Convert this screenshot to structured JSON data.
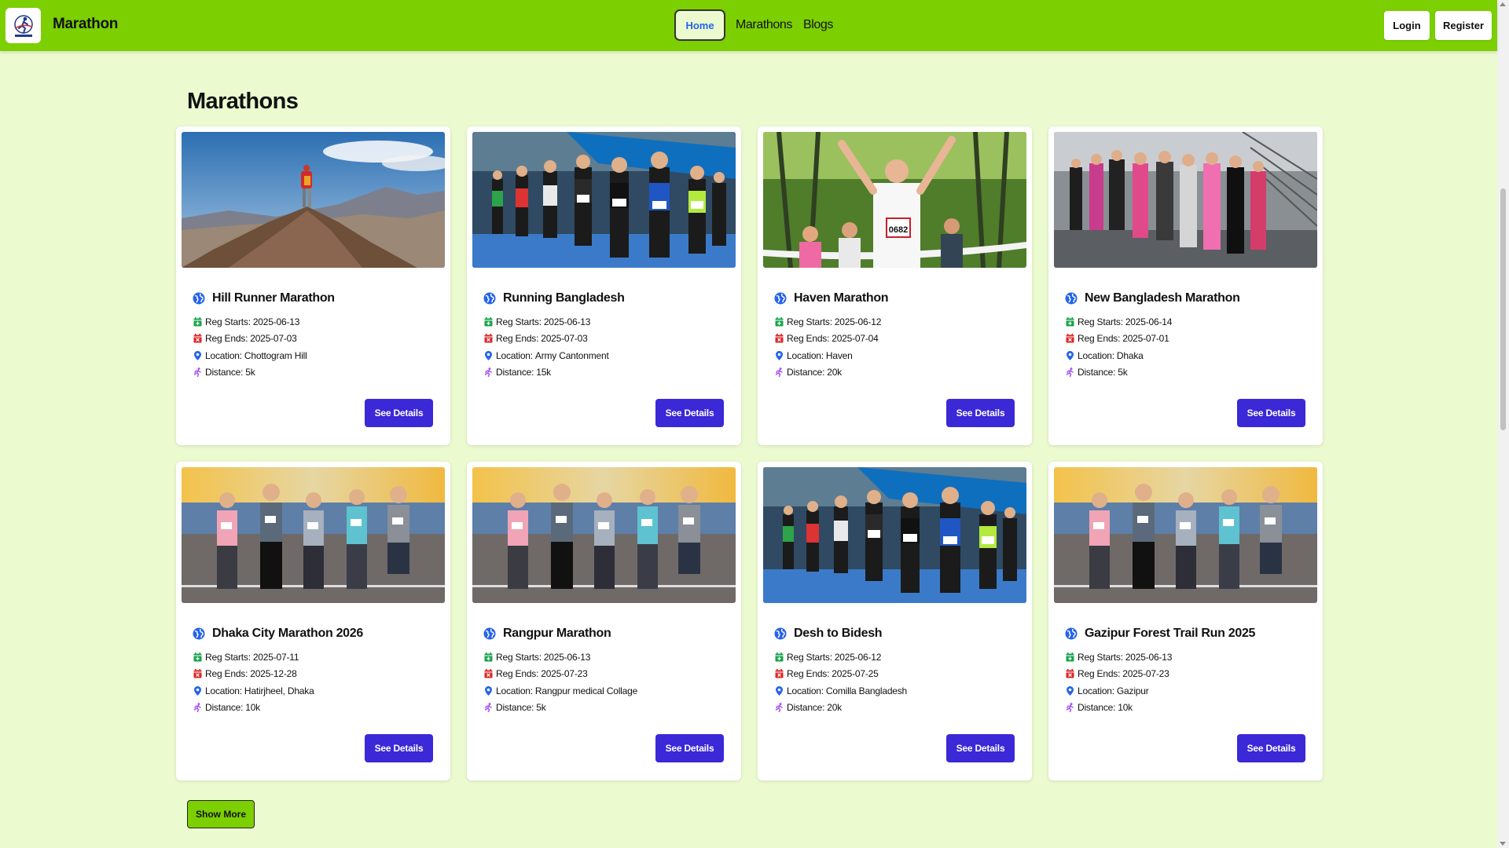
{
  "navbar": {
    "brand": "Marathon",
    "links": [
      {
        "label": "Home",
        "active": true
      },
      {
        "label": "Marathons"
      },
      {
        "label": "Blogs"
      }
    ],
    "login_label": "Login",
    "register_label": "Register"
  },
  "section_title": "Marathons",
  "labels": {
    "reg_starts": "Reg Starts:",
    "reg_ends": "Reg Ends:",
    "location": "Location:",
    "distance": "Distance:",
    "see_details": "See Details"
  },
  "cards": [
    {
      "title": "Hill Runner Marathon",
      "reg_starts": "2025-06-13",
      "reg_ends": "2025-07-03",
      "location": "Chottogram Hill",
      "distance": "5k",
      "image": "mountain"
    },
    {
      "title": "Running Bangladesh",
      "reg_starts": "2025-06-13",
      "reg_ends": "2025-07-03",
      "location": "Army Cantonment",
      "distance": "15k",
      "image": "crowd-race"
    },
    {
      "title": "Haven Marathon",
      "reg_starts": "2025-06-12",
      "reg_ends": "2025-07-04",
      "location": "Haven",
      "distance": "20k",
      "image": "finish-line"
    },
    {
      "title": "New Bangladesh Marathon",
      "reg_starts": "2025-06-14",
      "reg_ends": "2025-07-01",
      "location": "Dhaka",
      "distance": "5k",
      "image": "bridge-race"
    },
    {
      "title": "Dhaka City Marathon 2026",
      "reg_starts": "2025-07-11",
      "reg_ends": "2025-12-28",
      "location": "Hatirjheel, Dhaka",
      "distance": "10k",
      "image": "track-group"
    },
    {
      "title": "Rangpur Marathon",
      "reg_starts": "2025-06-13",
      "reg_ends": "2025-07-23",
      "location": "Rangpur medical Collage",
      "distance": "5k",
      "image": "track-group"
    },
    {
      "title": "Desh to Bidesh",
      "reg_starts": "2025-06-12",
      "reg_ends": "2025-07-25",
      "location": "Comilla Bangladesh",
      "distance": "20k",
      "image": "crowd-race"
    },
    {
      "title": "Gazipur Forest Trail Run 2025",
      "reg_starts": "2025-06-13",
      "reg_ends": "2025-07-23",
      "location": "Gazipur",
      "distance": "10k",
      "image": "track-group"
    }
  ],
  "show_more_label": "Show More",
  "colors": {
    "navbar": "#7ccf00",
    "background": "#ecfad0",
    "button": "#3b28d6",
    "globe_icon": "#2563eb",
    "calendar_start_icon": "#16a34a",
    "calendar_end_icon": "#dc2626",
    "location_icon": "#2563eb",
    "runner_icon": "#a855f7"
  }
}
